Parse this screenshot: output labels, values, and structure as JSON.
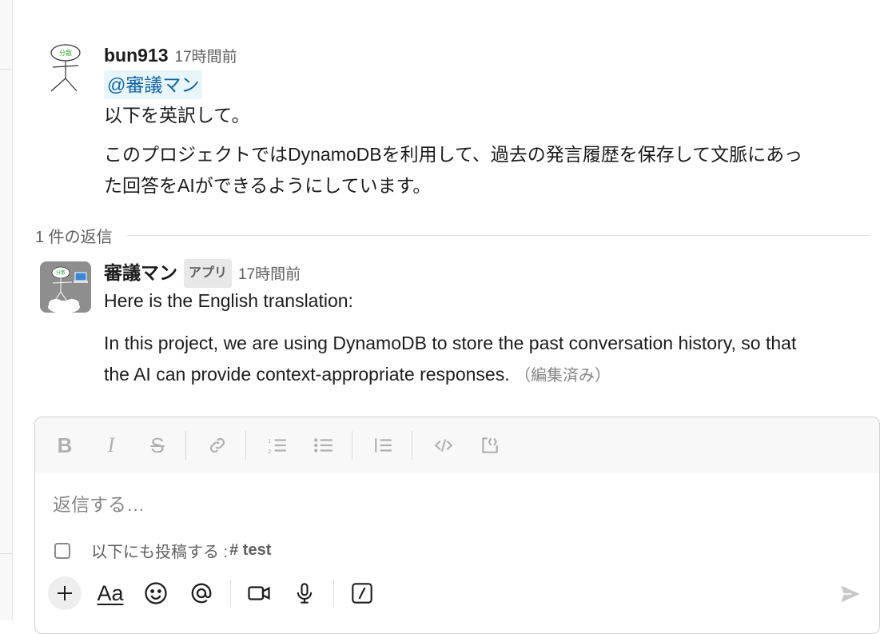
{
  "thread": {
    "parent": {
      "author": "bun913",
      "timestamp": "17時間前",
      "avatar_text": "分散",
      "mention": "@審議マン",
      "line1": "以下を英訳して。",
      "line2a": "このプロジェクトではDynamoDBを利用して、過去の発言履歴を保存して文脈にあっ",
      "line2b": "た回答をAIができるようにしています。"
    },
    "reply_count_label": "1 件の返信",
    "reply": {
      "author": "審議マン",
      "badge": "アプリ",
      "timestamp": "17時間前",
      "avatar_text": "分散",
      "line1": "Here is the English translation:",
      "line2a": "In this project, we are using DynamoDB to store the past conversation history, so that",
      "line2b": "the AI can provide context-appropriate responses.",
      "edited": "（編集済み）"
    }
  },
  "composer": {
    "format_buttons": [
      "bold-icon",
      "italic-icon",
      "strikethrough-icon",
      "link-icon",
      "ordered-list-icon",
      "bullet-list-icon",
      "blockquote-icon",
      "code-icon",
      "code-block-icon"
    ],
    "placeholder": "返信する…",
    "also_post_label": "以下にも投稿する :",
    "also_post_channel": "# test",
    "tools": [
      "plus-icon",
      "text-format-icon",
      "emoji-icon",
      "mention-icon",
      "video-icon",
      "microphone-icon",
      "slash-command-icon",
      "send-icon"
    ],
    "text_format_label": "Aa"
  },
  "colors": {
    "mention_bg": "#e8f5fa",
    "mention_text": "#1264a3",
    "muted": "#616061",
    "badge_bg": "#e8e8e8"
  }
}
